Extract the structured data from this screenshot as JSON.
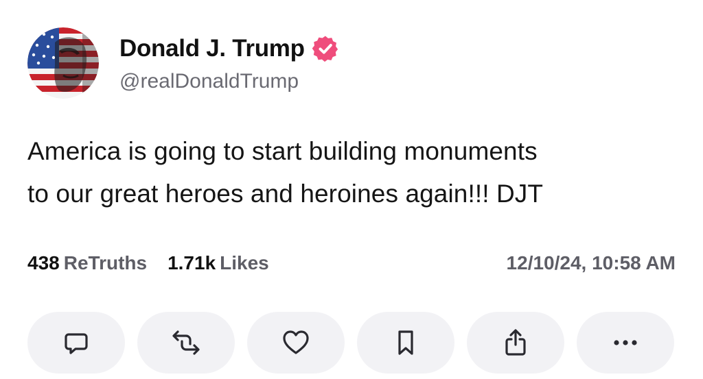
{
  "author": {
    "display_name": "Donald J. Trump",
    "handle": "@realDonaldTrump",
    "verified_badge_color": "#ef4d7c",
    "avatar_icon": "flag-portrait-avatar"
  },
  "post": {
    "line1": "America is going to start building monuments",
    "line2": "to our great heroes and heroines again!!! DJT"
  },
  "stats": {
    "retruths_count": "438",
    "retruths_label": "ReTruths",
    "likes_count": "1.71k",
    "likes_label": "Likes",
    "timestamp": "12/10/24, 10:58 AM"
  },
  "actions": [
    {
      "icon": "comment-icon"
    },
    {
      "icon": "retruth-icon"
    },
    {
      "icon": "heart-icon"
    },
    {
      "icon": "bookmark-icon"
    },
    {
      "icon": "share-icon"
    },
    {
      "icon": "more-icon"
    }
  ],
  "colors": {
    "text_primary": "#111111",
    "text_secondary": "#5e5e66",
    "button_background": "#f2f2f5",
    "icon_stroke": "#2a2a30"
  }
}
